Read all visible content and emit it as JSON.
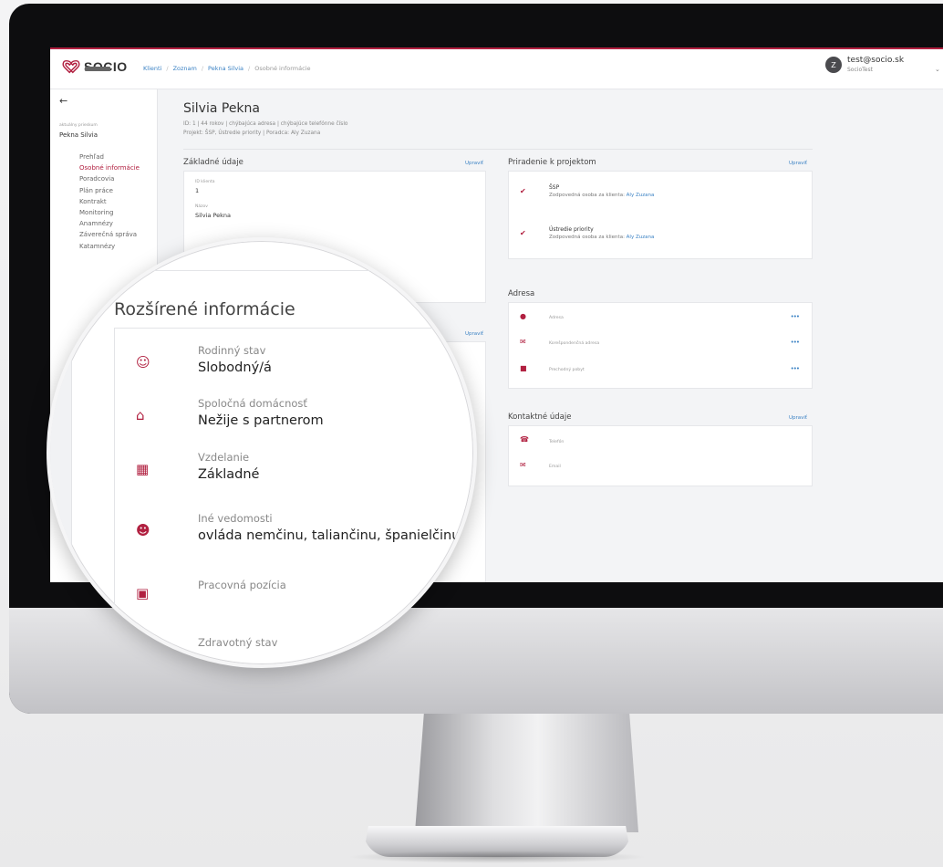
{
  "app": {
    "logo_text": "SOCIO"
  },
  "breadcrumb": [
    "Klienti",
    "Zoznam",
    "Pekna Silvia",
    "Osobné informácie"
  ],
  "user": {
    "initial": "Z",
    "email": "test@socio.sk",
    "org": "SocioTest"
  },
  "sidebar": {
    "caption": "aktuálny prieskum",
    "client_name": "Pekna Silvia",
    "items": [
      {
        "label": "Prehľad",
        "active": false
      },
      {
        "label": "Osobné informácie",
        "active": true
      },
      {
        "label": "Poradcovia",
        "active": false
      },
      {
        "label": "Plán práce",
        "active": false
      },
      {
        "label": "Kontrakt",
        "active": false
      },
      {
        "label": "Monitoring",
        "active": false
      },
      {
        "label": "Anamnézy",
        "active": false
      },
      {
        "label": "Záverečná správa",
        "active": false
      },
      {
        "label": "Katamnézy",
        "active": false
      }
    ]
  },
  "person": {
    "name": "Silvia Pekna",
    "meta_line1": "ID: 1  |  44 rokov  |  chýbajúca adresa  |  chýbajúce telefónne číslo",
    "meta_line2": "Projekt: ŠSP, Ústredie priority  |  Poradca: Aly Zuzana"
  },
  "basic_info": {
    "title": "Základné údaje",
    "edit": "Upraviť",
    "fields": [
      {
        "label": "ID klienta",
        "value": "1"
      },
      {
        "label": "Názov",
        "value": "Silvia Pekna"
      }
    ]
  },
  "extended_edit": "Upraviť",
  "projects": {
    "title": "Priradenie k projektom",
    "edit": "Upraviť",
    "items": [
      {
        "name": "ŠSP",
        "responsible_label": "Zodpovedná osoba za klienta:",
        "responsible": "Aly Zuzana"
      },
      {
        "name": "Ústredie priority",
        "responsible_label": "Zodpovedná osoba za klienta:",
        "responsible": "Aly Zuzana"
      }
    ]
  },
  "address": {
    "title": "Adresa",
    "items": [
      {
        "label": "Adresa",
        "icon": "map-pin-icon",
        "more": "•••"
      },
      {
        "label": "Korešpondenčná adresa",
        "icon": "envelope-icon",
        "more": "•••"
      },
      {
        "label": "Prechodný pobyt",
        "icon": "building-icon",
        "more": "•••"
      }
    ]
  },
  "contact": {
    "title": "Kontaktné údaje",
    "edit": "Upraviť",
    "items": [
      {
        "label": "Telefón",
        "icon": "phone-icon"
      },
      {
        "label": "Email",
        "icon": "envelope-icon"
      }
    ]
  },
  "magnifier": {
    "title": "Rozšírené informácie",
    "items": [
      {
        "icon": "users-gear-icon",
        "label": "Rodinný stav",
        "value": "Slobodný/á"
      },
      {
        "icon": "home-icon",
        "label": "Spoločná domácnosť",
        "value": "Nežije s partnerom"
      },
      {
        "icon": "certificate-icon",
        "label": "Vzdelanie",
        "value": "Základné"
      },
      {
        "icon": "user-gear-icon",
        "label": "Iné vedomosti",
        "value": "ovláda nemčinu, taliančinu, španielčinu"
      },
      {
        "icon": "briefcase-icon",
        "label": "Pracovná pozícia",
        "value": ""
      },
      {
        "icon": "heartbeat-icon",
        "label": "Zdravotný stav",
        "value": ""
      }
    ]
  },
  "colors": {
    "accent": "#b12040",
    "link": "#3b82c4"
  }
}
